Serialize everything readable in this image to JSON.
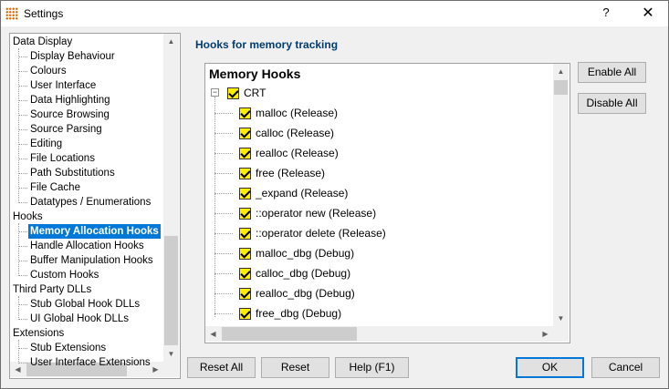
{
  "window": {
    "title": "Settings",
    "help_label": "?",
    "close_label": "✕"
  },
  "tree": {
    "items": [
      {
        "label": "Data Display",
        "level": 0
      },
      {
        "label": "Display Behaviour",
        "level": 1
      },
      {
        "label": "Colours",
        "level": 1
      },
      {
        "label": "User Interface",
        "level": 1
      },
      {
        "label": "Data Highlighting",
        "level": 1
      },
      {
        "label": "Source Browsing",
        "level": 1
      },
      {
        "label": "Source Parsing",
        "level": 1
      },
      {
        "label": "Editing",
        "level": 1
      },
      {
        "label": "File Locations",
        "level": 1
      },
      {
        "label": "Path Substitutions",
        "level": 1
      },
      {
        "label": "File Cache",
        "level": 1
      },
      {
        "label": "Datatypes / Enumerations",
        "level": 1
      },
      {
        "label": "Hooks",
        "level": 0
      },
      {
        "label": "Memory Allocation Hooks",
        "level": 1,
        "selected": true
      },
      {
        "label": "Handle Allocation Hooks",
        "level": 1
      },
      {
        "label": "Buffer Manipulation Hooks",
        "level": 1
      },
      {
        "label": "Custom Hooks",
        "level": 1
      },
      {
        "label": "Third Party DLLs",
        "level": 0
      },
      {
        "label": "Stub Global Hook DLLs",
        "level": 1
      },
      {
        "label": "UI Global Hook DLLs",
        "level": 1
      },
      {
        "label": "Extensions",
        "level": 0
      },
      {
        "label": "Stub Extensions",
        "level": 1
      },
      {
        "label": "User Interface Extensions",
        "level": 1
      }
    ]
  },
  "main": {
    "section_title": "Hooks for memory tracking",
    "list_header": "Memory Hooks",
    "group": {
      "label": "CRT",
      "expander": "−",
      "checked": true
    },
    "hooks": [
      {
        "label": "malloc (Release)",
        "checked": true
      },
      {
        "label": "calloc (Release)",
        "checked": true
      },
      {
        "label": "realloc (Release)",
        "checked": true
      },
      {
        "label": "free (Release)",
        "checked": true
      },
      {
        "label": "_expand (Release)",
        "checked": true
      },
      {
        "label": "::operator new (Release)",
        "checked": true
      },
      {
        "label": "::operator delete (Release)",
        "checked": true
      },
      {
        "label": "malloc_dbg (Debug)",
        "checked": true
      },
      {
        "label": "calloc_dbg (Debug)",
        "checked": true
      },
      {
        "label": "realloc_dbg (Debug)",
        "checked": true
      },
      {
        "label": "free_dbg (Debug)",
        "checked": true
      }
    ],
    "enable_all_label": "Enable All",
    "disable_all_label": "Disable All"
  },
  "footer": {
    "reset_all_label": "Reset All",
    "reset_label": "Reset",
    "help_label": "Help (F1)",
    "ok_label": "OK",
    "cancel_label": "Cancel"
  }
}
